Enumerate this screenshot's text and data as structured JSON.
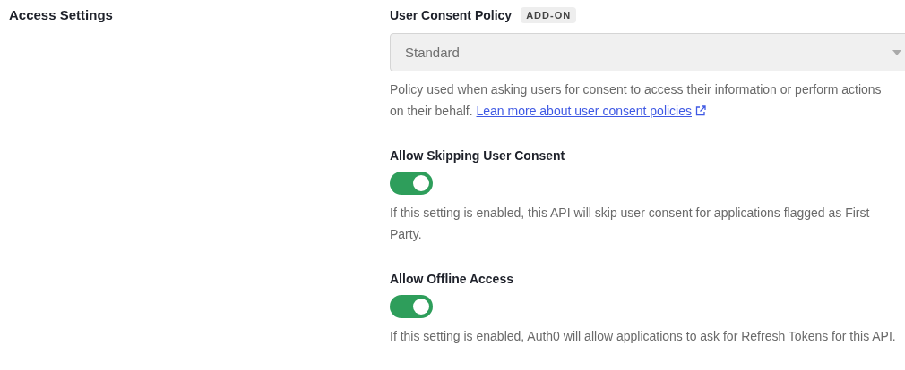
{
  "section": {
    "title": "Access Settings"
  },
  "consent_policy": {
    "label": "User Consent Policy",
    "badge": "ADD-ON",
    "value": "Standard",
    "disabled": true,
    "description": "Policy used when asking users for consent to access their information or perform actions on their behalf.",
    "link": "Lean more about user consent policies"
  },
  "toggles": [
    {
      "label": "Allow Skipping User Consent",
      "on": true,
      "description": "If this setting is enabled, this API will skip user consent for applications flagged as First Party."
    },
    {
      "label": "Allow Offline Access",
      "on": true,
      "description": "If this setting is enabled, Auth0 will allow applications to ask for Refresh Tokens for this API."
    }
  ]
}
